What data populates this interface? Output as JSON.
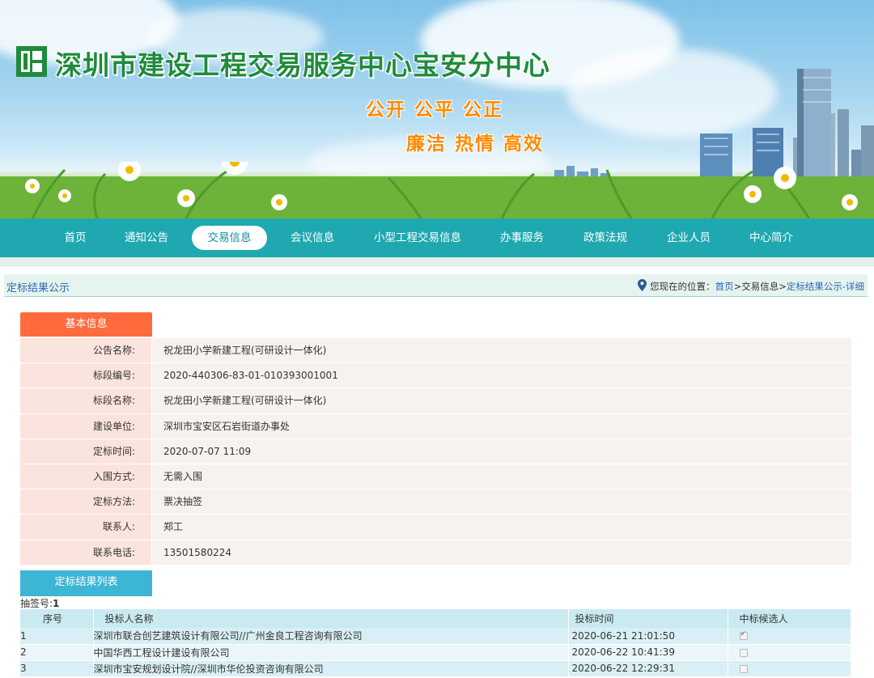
{
  "site": {
    "title": "深圳市建设工程交易服务中心宝安分中心",
    "slogan1": "公开  公平  公正",
    "slogan2": "廉洁  热情  高效"
  },
  "nav": {
    "items": [
      "首页",
      "通知公告",
      "交易信息",
      "会议信息",
      "小型工程交易信息",
      "办事服务",
      "政策法规",
      "企业人员",
      "中心简介"
    ],
    "active_index": 2
  },
  "breadcrumb": {
    "page_title": "定标结果公示",
    "prefix": "您现在的位置：",
    "home": "首页",
    "sep": ">",
    "mid": "交易信息",
    "current": "定标结果公示-详细"
  },
  "basic": {
    "tab_label": "基本信息",
    "rows": [
      {
        "label": "公告名称:",
        "value": "祝龙田小学新建工程(可研设计一体化)"
      },
      {
        "label": "标段编号:",
        "value": "2020-440306-83-01-010393001001"
      },
      {
        "label": "标段名称:",
        "value": "祝龙田小学新建工程(可研设计一体化)"
      },
      {
        "label": "建设单位:",
        "value": "深圳市宝安区石岩街道办事处"
      },
      {
        "label": "定标时间:",
        "value": "2020-07-07 11:09"
      },
      {
        "label": "入围方式:",
        "value": "无需入围"
      },
      {
        "label": "定标方法:",
        "value": "票决抽签"
      },
      {
        "label": "联系人:",
        "value": "郑工"
      },
      {
        "label": "联系电话:",
        "value": "13501580224"
      }
    ]
  },
  "result": {
    "tab_label": "定标结果列表",
    "draw_label": "抽签号:",
    "draw_value": "1",
    "headers": [
      "序号",
      "投标人名称",
      "投标时间",
      "中标候选人"
    ],
    "rows": [
      {
        "no": "1",
        "name": "深圳市联合创艺建筑设计有限公司//广州金良工程咨询有限公司",
        "time": "2020-06-21 21:01:50",
        "candidate": true
      },
      {
        "no": "2",
        "name": "中国华西工程设计建设有限公司",
        "time": "2020-06-22 10:41:39",
        "candidate": false
      },
      {
        "no": "3",
        "name": "深圳市宝安规划设计院//深圳市华伦投资咨询有限公司",
        "time": "2020-06-22 12:29:31",
        "candidate": false
      }
    ]
  },
  "colors": {
    "nav_bg": "#1fa8b0",
    "title_green": "#1f8b3c",
    "slogan_orange": "#ff8a00",
    "tab_basic": "#ff6b3d",
    "tab_result": "#3db6d5"
  },
  "icons": [
    "logo-icon",
    "location-pin-icon",
    "checkbox-icon"
  ]
}
